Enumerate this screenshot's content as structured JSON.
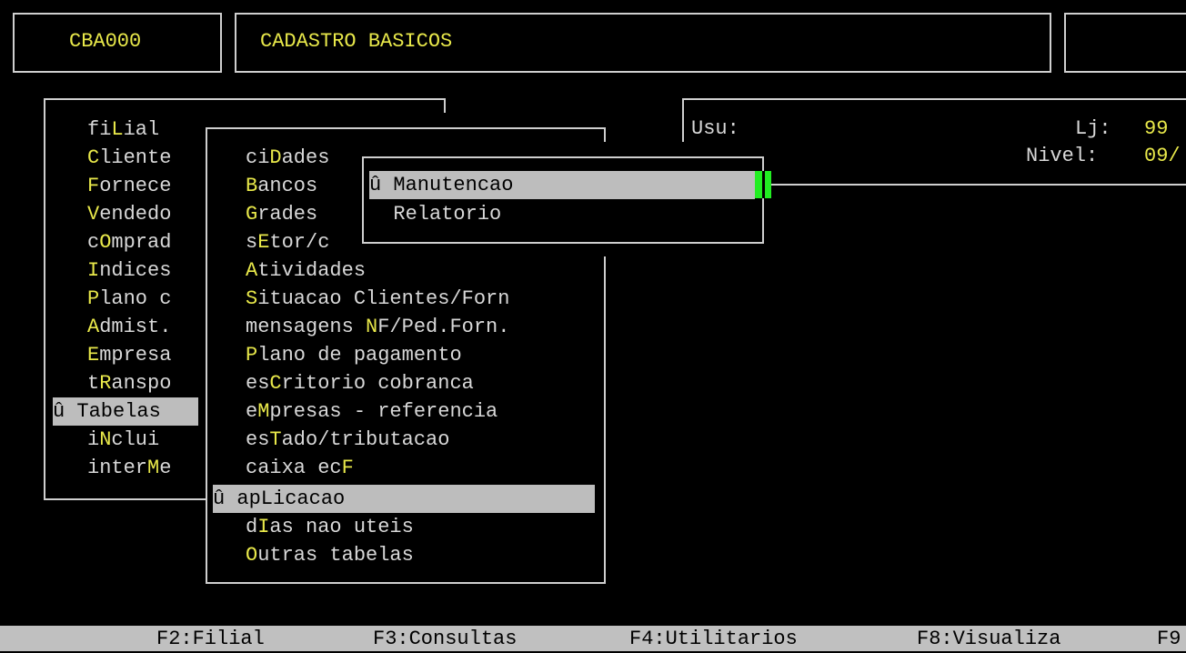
{
  "header": {
    "program_code": "CBA000",
    "program_title": "CADASTRO BASICOS"
  },
  "info_panel": {
    "user_label": "Usu:",
    "store_label": "Lj:",
    "store_value": "99",
    "level_label": "Nivel:",
    "level_value": "09/"
  },
  "main_menu": {
    "items": [
      {
        "pre": "fi",
        "hot": "L",
        "post": "ial"
      },
      {
        "pre": "",
        "hot": "C",
        "post": "liente"
      },
      {
        "pre": "",
        "hot": "F",
        "post": "ornece"
      },
      {
        "pre": "",
        "hot": "V",
        "post": "endedo"
      },
      {
        "pre": "c",
        "hot": "O",
        "post": "mprad"
      },
      {
        "pre": "",
        "hot": "I",
        "post": "ndices"
      },
      {
        "pre": "",
        "hot": "P",
        "post": "lano c"
      },
      {
        "pre": "",
        "hot": "A",
        "post": "dmist."
      },
      {
        "pre": "",
        "hot": "E",
        "post": "mpresa"
      },
      {
        "pre": "t",
        "hot": "R",
        "post": "anspo"
      },
      {
        "pre": "û ",
        "hot": "",
        "post": "Tabelas"
      },
      {
        "pre": "i",
        "hot": "N",
        "post": "clui"
      },
      {
        "pre": "inter",
        "hot": "M",
        "post": "e"
      }
    ]
  },
  "tables_menu": {
    "items": [
      {
        "pre": "ci",
        "hot": "D",
        "post": "ades"
      },
      {
        "pre": "",
        "hot": "B",
        "post": "ancos"
      },
      {
        "pre": "",
        "hot": "G",
        "post": "rades"
      },
      {
        "pre": "s",
        "hot": "E",
        "post": "tor/c"
      },
      {
        "pre": "",
        "hot": "A",
        "post": "tividades"
      },
      {
        "pre": "",
        "hot": "S",
        "post": "ituacao Clientes/Forn"
      },
      {
        "pre": "mensagens ",
        "hot": "N",
        "post": "F/Ped.Forn."
      },
      {
        "pre": "",
        "hot": "P",
        "post": "lano de pagamento"
      },
      {
        "pre": "es",
        "hot": "C",
        "post": "ritorio cobranca"
      },
      {
        "pre": "e",
        "hot": "M",
        "post": "presas - referencia"
      },
      {
        "pre": "es",
        "hot": "T",
        "post": "ado/tributacao"
      },
      {
        "pre": "caixa ec",
        "hot": "F",
        "post": ""
      },
      {
        "pre": "û apLicacao",
        "hot": "",
        "post": ""
      },
      {
        "pre": "d",
        "hot": "I",
        "post": "as nao uteis"
      },
      {
        "pre": "",
        "hot": "O",
        "post": "utras tabelas"
      }
    ]
  },
  "action_menu": {
    "items": [
      {
        "label": "û Manutencao"
      },
      {
        "label": "  Relatorio"
      }
    ]
  },
  "function_keys": [
    {
      "label": "F2:Filial"
    },
    {
      "label": "F3:Consultas"
    },
    {
      "label": "F4:Utilitarios"
    },
    {
      "label": "F8:Visualiza"
    },
    {
      "label": "F9"
    }
  ],
  "colors": {
    "hotkey": "#e8e84a",
    "selection_bg": "#bdbdbd",
    "cursor": "#22ee22"
  }
}
